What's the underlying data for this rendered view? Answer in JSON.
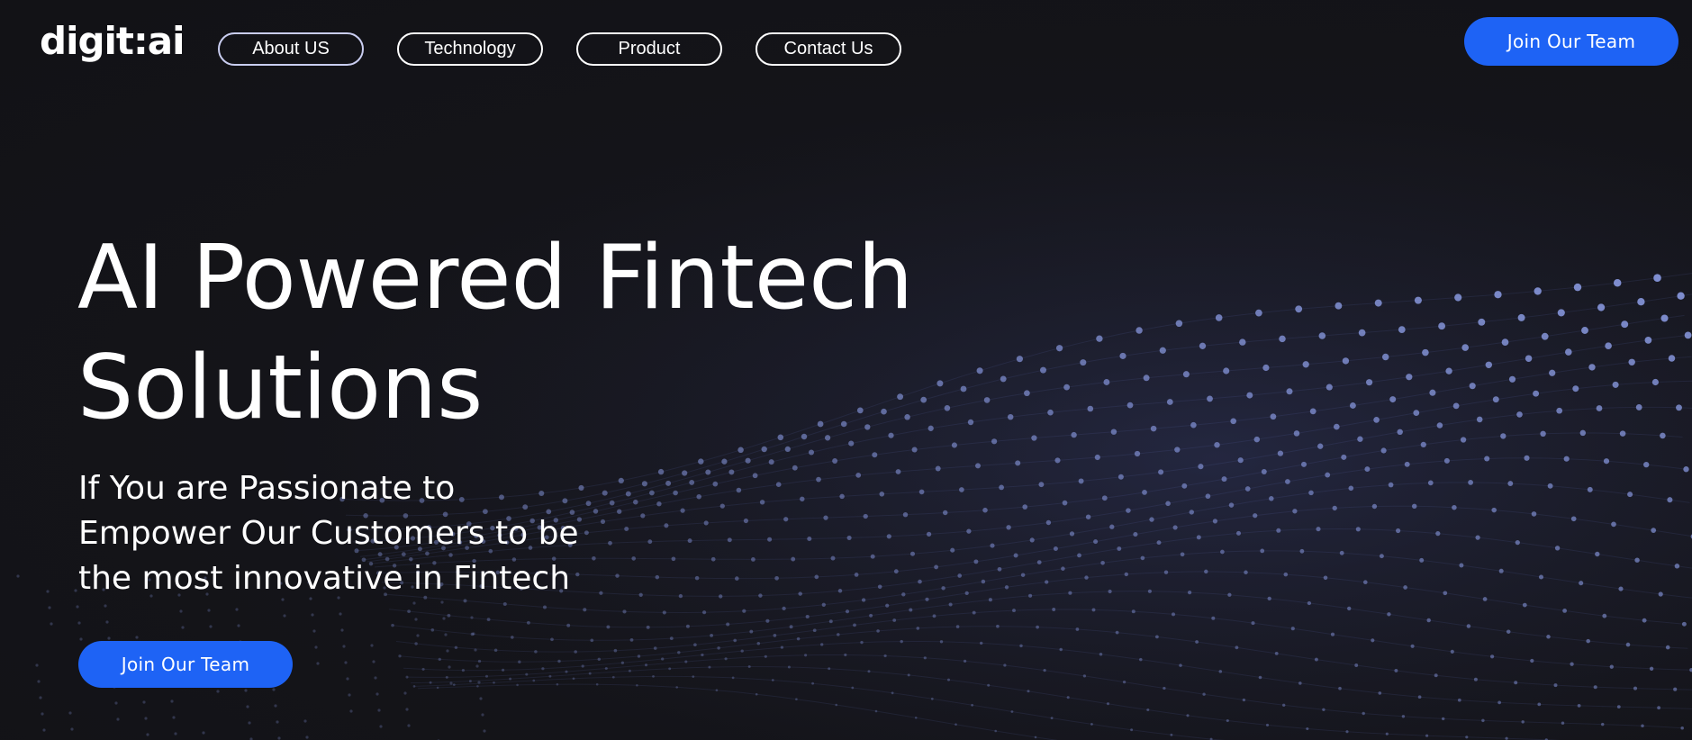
{
  "brand": {
    "logo_text": "digit:ai"
  },
  "nav": {
    "items": [
      {
        "label": "About US"
      },
      {
        "label": "Technology"
      },
      {
        "label": "Product"
      },
      {
        "label": "Contact Us"
      }
    ]
  },
  "header": {
    "cta_label": "Join Our Team"
  },
  "hero": {
    "title_line1": "AI Powered Fintech",
    "title_line2": "Solutions",
    "subtitle_line1": "If You are Passionate to",
    "subtitle_line2": "Empower Our Customers to be",
    "subtitle_line3": "the most innovative in Fintech",
    "cta_label": "Join Our Team"
  },
  "colors": {
    "background": "#141419",
    "accent": "#1e63f5",
    "dots": "#8fa0ea"
  },
  "decor": {
    "background_visual": "particle-wave-icon"
  }
}
